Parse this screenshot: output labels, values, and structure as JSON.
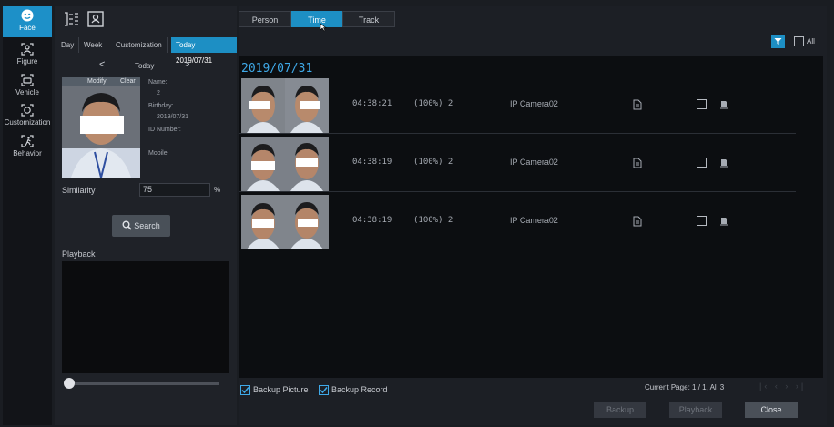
{
  "nav": [
    {
      "label": "Face",
      "icon": "face-icon",
      "active": true
    },
    {
      "label": "Figure",
      "icon": "figure-icon",
      "active": false
    },
    {
      "label": "Vehicle",
      "icon": "vehicle-icon",
      "active": false
    },
    {
      "label": "Customization",
      "icon": "customization-icon",
      "active": false
    },
    {
      "label": "Behavior",
      "icon": "behavior-icon",
      "active": false
    }
  ],
  "left": {
    "ranges": [
      "Day",
      "Week",
      "Customization",
      "Today 2019/07/31"
    ],
    "prev": "<",
    "next": ">",
    "today_label": "Today",
    "thumb_modify": "Modify",
    "thumb_clear": "Clear",
    "info": {
      "name_label": "Name:",
      "name_value": "2",
      "birthday_label": "Birthday:",
      "birthday_value": "2019/07/31",
      "id_label": "ID Number:",
      "mobile_label": "Mobile:"
    },
    "similarity_label": "Similarity",
    "similarity_value": "75",
    "similarity_unit": "%",
    "search_label": "Search",
    "playback_label": "Playback"
  },
  "right": {
    "tabs": [
      "Person",
      "Time",
      "Track"
    ],
    "active_tab": "Time",
    "all_label": "All",
    "date_title": "2019/07/31",
    "rows": [
      {
        "time": "04:38:21",
        "score": "(100%) 2",
        "camera": "IP Camera02"
      },
      {
        "time": "04:38:19",
        "score": "(100%) 2",
        "camera": "IP Camera02"
      },
      {
        "time": "04:38:19",
        "score": "(100%) 2",
        "camera": "IP Camera02"
      }
    ],
    "backup_picture": "Backup Picture",
    "backup_record": "Backup Record",
    "page_info": "Current Page: 1 / 1, All 3",
    "buttons": {
      "backup": "Backup",
      "playback": "Playback",
      "close": "Close"
    }
  },
  "colors": {
    "accent": "#1d8fc4",
    "date": "#3fa9e8"
  }
}
